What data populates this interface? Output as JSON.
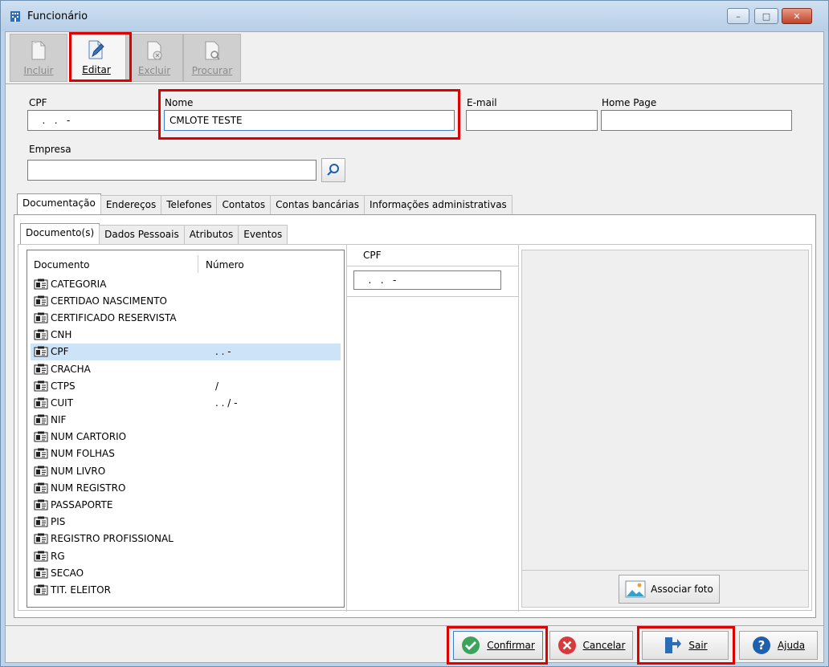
{
  "window": {
    "title": "Funcionário",
    "minimize": "–",
    "maximize": "□",
    "close": "✕"
  },
  "toolbar": {
    "incluir": "Incluir",
    "editar": "Editar",
    "excluir": "Excluir",
    "procurar": "Procurar"
  },
  "form": {
    "cpf_label": "CPF",
    "cpf_value": "   .   .   -",
    "nome_label": "Nome",
    "nome_value": "CMLOTE TESTE",
    "email_label": "E-mail",
    "email_value": "",
    "homepage_label": "Home Page",
    "homepage_value": "",
    "empresa_label": "Empresa",
    "empresa_value": ""
  },
  "tabs": [
    "Documentação",
    "Endereços",
    "Telefones",
    "Contatos",
    "Contas bancárias",
    "Informações administrativas"
  ],
  "subtabs": [
    "Documento(s)",
    "Dados Pessoais",
    "Atributos",
    "Eventos"
  ],
  "documents": {
    "col_documento": "Documento",
    "col_numero": "Número",
    "rows": [
      {
        "name": "CATEGORIA",
        "value": ""
      },
      {
        "name": "CERTIDAO NASCIMENTO",
        "value": ""
      },
      {
        "name": "CERTIFICADO RESERVISTA",
        "value": ""
      },
      {
        "name": "CNH",
        "value": ""
      },
      {
        "name": "CPF",
        "value": "  .   .   -"
      },
      {
        "name": "CRACHA",
        "value": ""
      },
      {
        "name": "CTPS",
        "value": "     /"
      },
      {
        "name": "CUIT",
        "value": "  .   .   /   -"
      },
      {
        "name": "NIF",
        "value": ""
      },
      {
        "name": "NUM CARTORIO",
        "value": ""
      },
      {
        "name": "NUM FOLHAS",
        "value": ""
      },
      {
        "name": "NUM LIVRO",
        "value": ""
      },
      {
        "name": "NUM REGISTRO",
        "value": ""
      },
      {
        "name": "PASSAPORTE",
        "value": ""
      },
      {
        "name": "PIS",
        "value": ""
      },
      {
        "name": "REGISTRO PROFISSIONAL",
        "value": ""
      },
      {
        "name": "RG",
        "value": ""
      },
      {
        "name": "SECAO",
        "value": ""
      },
      {
        "name": "TIT. ELEITOR",
        "value": ""
      }
    ]
  },
  "detail": {
    "header": "CPF",
    "value": "   .   .   -"
  },
  "photo": {
    "button": "Associar foto"
  },
  "footer": {
    "confirmar": "Confirmar",
    "cancelar": "Cancelar",
    "sair": "Sair",
    "ajuda": "Ajuda"
  }
}
